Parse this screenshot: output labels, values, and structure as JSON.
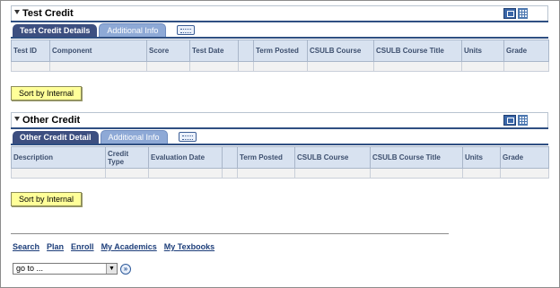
{
  "test_credit": {
    "title": "Test Credit",
    "tabs": [
      "Test Credit Details",
      "Additional Info"
    ],
    "columns": [
      "Test ID",
      "Component",
      "Score",
      "Test Date",
      "",
      "Term Posted",
      "CSULB Course",
      "CSULB Course Title",
      "Units",
      "Grade"
    ],
    "button_label": "Sort by Internal"
  },
  "other_credit": {
    "title": "Other Credit",
    "tabs": [
      "Other Credit Detail",
      "Additional Info"
    ],
    "columns": [
      "Description",
      "Credit Type",
      "Evaluation Date",
      "",
      "Term Posted",
      "CSULB Course",
      "CSULB Course Title",
      "Units",
      "Grade"
    ],
    "button_label": "Sort by Internal"
  },
  "footer": {
    "links": [
      "Search",
      "Plan",
      "Enroll",
      "My Academics",
      "My Texbooks"
    ],
    "goto_value": "go to ..."
  },
  "icons": {
    "collapse": "collapse-triangle-icon",
    "zoom": "zoom-icon",
    "grid": "download-grid-icon",
    "show_all_columns": "show-all-columns-icon",
    "go": "go-arrow-icon"
  },
  "colors": {
    "active_tab": "#3d4f80",
    "inactive_tab": "#8ea9d6",
    "header_fill": "#d8e2f0",
    "button_fill": "#ffff99",
    "link": "#1d3e7a"
  }
}
